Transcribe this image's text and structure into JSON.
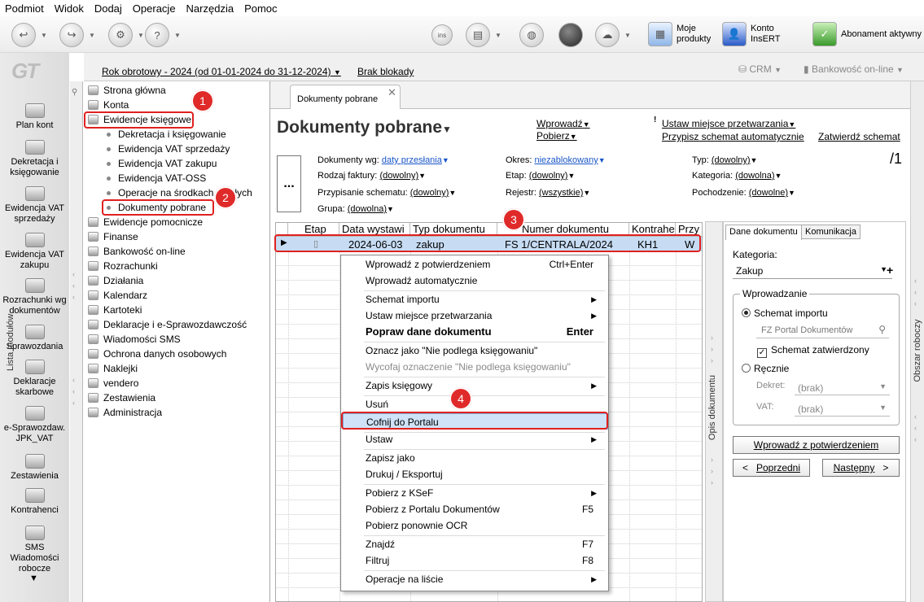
{
  "menubar": [
    "Podmiot",
    "Widok",
    "Dodaj",
    "Operacje",
    "Narzędzia",
    "Pomoc"
  ],
  "toolbar": {
    "moje_produkty": "Moje produkty",
    "konto_insert": "Konto InsERT",
    "abonament": "Abonament aktywny",
    "crm": "CRM",
    "bankowosc": "Bankowość on-line"
  },
  "logo": "GT",
  "rail": [
    {
      "label": "Plan kont"
    },
    {
      "label": "Dekretacja i księgowanie"
    },
    {
      "label": "Ewidencja VAT sprzedaży"
    },
    {
      "label": "Ewidencja VAT zakupu"
    },
    {
      "label": "Rozrachunki wg dokumentów"
    },
    {
      "label": "Sprawozdania"
    },
    {
      "label": "Deklaracje skarbowe"
    },
    {
      "label": "e-Sprawozdaw. JPK_VAT"
    },
    {
      "label": "Zestawienia"
    },
    {
      "label": "Kontrahenci"
    },
    {
      "label": "SMS Wiadomości robocze"
    }
  ],
  "topbar": {
    "rok": "Rok obrotowy - 2024  (od 01-01-2024 do 31-12-2024)",
    "blokada": "Brak blokady"
  },
  "modules": {
    "title": "Lista modułów",
    "items": [
      "Strona główna",
      "Konta",
      "Ewidencje księgowe"
    ],
    "subitems": [
      "Dekretacja i księgowanie",
      "Ewidencja VAT sprzedaży",
      "Ewidencja VAT zakupu",
      "Ewidencja VAT-OSS",
      "Operacje na środkach trwałych",
      "Dokumenty pobrane"
    ],
    "items2": [
      "Ewidencje pomocnicze",
      "Finanse",
      "Bankowość on-line",
      "Rozrachunki",
      "Działania",
      "Kalendarz",
      "Kartoteki",
      "Deklaracje i e-Sprawozdawczość",
      "Wiadomości SMS",
      "Ochrona danych osobowych",
      "Naklejki",
      "vendero",
      "Zestawienia",
      "Administracja"
    ]
  },
  "badges": [
    "1",
    "2",
    "3",
    "4"
  ],
  "tab": {
    "label": "Dokumenty pobrane",
    "close": "✕"
  },
  "page": {
    "title": "Dokumenty pobrane",
    "wprowadz": "Wprowadź",
    "pobierz": "Pobierz",
    "ustaw": "Ustaw miejsce przetwarzania",
    "przypisz": "Przypisz schemat automatycznie",
    "zatwierdz": "Zatwierdź schemat",
    "count": "/1",
    "dots": "..."
  },
  "filters": {
    "dokumenty_wg_label": "Dokumenty wg:",
    "dokumenty_wg_value": "daty przesłania",
    "rodzaj_label": "Rodzaj faktury:",
    "rodzaj_value": "(dowolny)",
    "przypisanie_label": "Przypisanie schematu:",
    "przypisanie_value": "(dowolny)",
    "grupa_label": "Grupa:",
    "grupa_value": "(dowolna)",
    "okres_label": "Okres:",
    "okres_value": "niezablokowany",
    "etap_label": "Etap:",
    "etap_value": "(dowolny)",
    "rejestr_label": "Rejestr:",
    "rejestr_value": "(wszystkie)",
    "typ_label": "Typ:",
    "typ_value": "(dowolny)",
    "kategoria_label": "Kategoria:",
    "kategoria_value": "(dowolna)",
    "pochodzenie_label": "Pochodzenie:",
    "pochodzenie_value": "(dowolne)"
  },
  "grid": {
    "headers": [
      "Etap",
      "Data wystawi",
      "Typ dokumentu",
      "Numer dokumentu",
      "Kontrahe",
      "Przy"
    ],
    "row": {
      "data": "2024-06-03",
      "typ": "zakup",
      "numer": "FS 1/CENTRALA/2024",
      "kontrahent": "KH1",
      "przy": "W"
    }
  },
  "context_menu": [
    {
      "label": "Wprowadź z potwierdzeniem",
      "shortcut": "Ctrl+Enter"
    },
    {
      "label": "Wprowadź automatycznie"
    },
    {
      "label": "Schemat importu",
      "submenu": true
    },
    {
      "label": "Ustaw miejsce przetwarzania",
      "submenu": true
    },
    {
      "label": "Popraw dane dokumentu",
      "shortcut": "Enter",
      "bold": true
    },
    {
      "label": "Oznacz jako \"Nie podlega księgowaniu\""
    },
    {
      "label": "Wycofaj oznaczenie \"Nie podlega księgowaniu\"",
      "disabled": true
    },
    {
      "label": "Zapis księgowy",
      "submenu": true
    },
    {
      "label": "Usuń"
    },
    {
      "label": "Cofnij do Portalu",
      "highlight": true
    },
    {
      "label": "Ustaw",
      "submenu": true
    },
    {
      "label": "Zapisz jako"
    },
    {
      "label": "Drukuj / Eksportuj"
    },
    {
      "label": "Pobierz z KSeF",
      "submenu": true
    },
    {
      "label": "Pobierz z Portalu Dokumentów",
      "shortcut": "F5"
    },
    {
      "label": "Pobierz ponownie OCR"
    },
    {
      "label": "Znajdź",
      "shortcut": "F7"
    },
    {
      "label": "Filtruj",
      "shortcut": "F8"
    },
    {
      "label": "Operacje na liście",
      "submenu": true
    }
  ],
  "right": {
    "opis": "Opis dokumentu",
    "tabs": [
      "Dane dokumentu",
      "Komunikacja"
    ],
    "kategoria_label": "Kategoria:",
    "kategoria_value": "Zakup",
    "wprowadzanie": "Wprowadzanie",
    "schemat_importu": "Schemat importu",
    "schemat_value": "FZ Portal Dokumentów",
    "zatwierdzony": "Schemat zatwierdzony",
    "recznie": "Ręcznie",
    "dekret_label": "Dekret:",
    "dekret_value": "(brak)",
    "vat_label": "VAT:",
    "vat_value": "(brak)",
    "btn_wprowadz": "Wprowadź z potwierdzeniem",
    "btn_poprzedni": "Poprzedni",
    "btn_nastepny": "Następny",
    "obszar": "Obszar roboczy"
  },
  "colors": {
    "accent_red": "#e02020",
    "selection": "#c7dcf3",
    "link_blue": "#1a56c8"
  }
}
